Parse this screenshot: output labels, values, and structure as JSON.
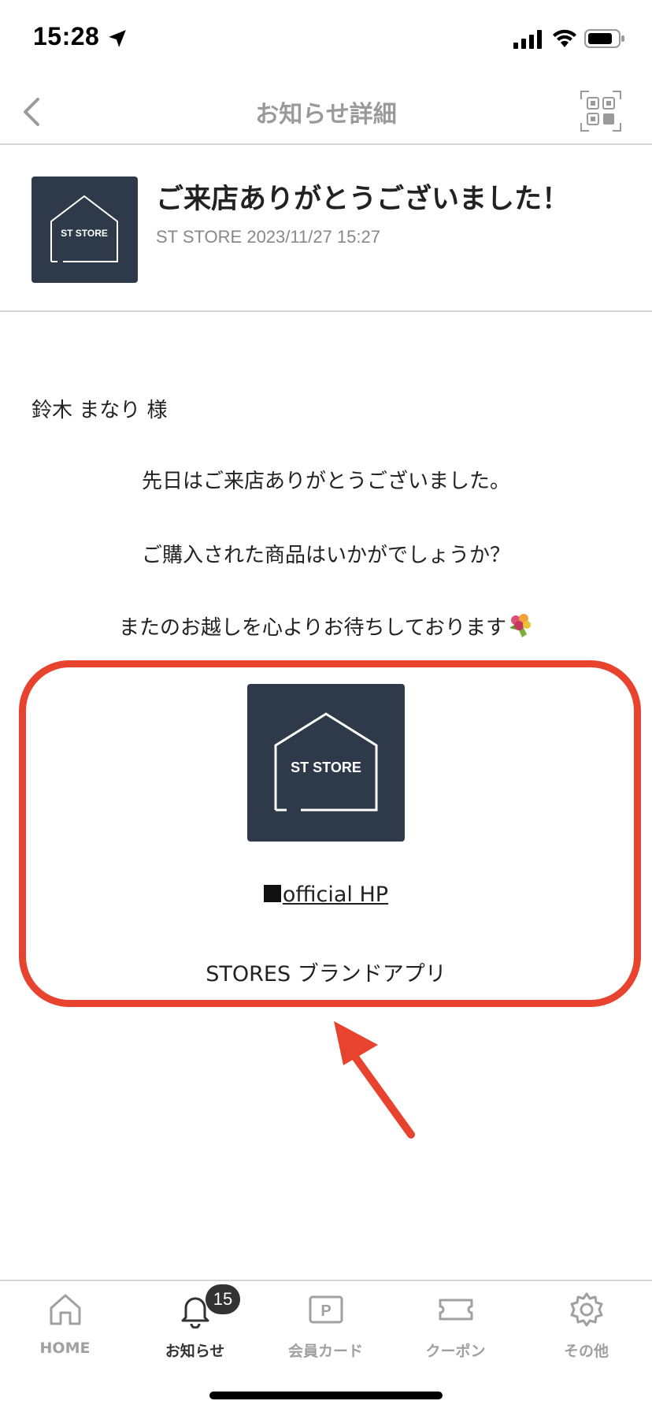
{
  "status_bar": {
    "time": "15:28"
  },
  "nav": {
    "title": "お知らせ詳細"
  },
  "message": {
    "title": "ご来店ありがとうございました！",
    "meta": "ST STORE 2023/11/27 15:27",
    "logo_text": "ST STORE",
    "recipient": "鈴木 まなり 様",
    "lines": [
      "先日はご来店ありがとうございました。",
      "ご購入された商品はいかがでしょうか？",
      "またのお越しを心よりお待ちしております"
    ]
  },
  "highlight": {
    "logo_text": "ST STORE",
    "official_prefix": "■",
    "official_link": "official HP",
    "brand_app": "STORES ブランドアプリ",
    "box_color": "#e8432e"
  },
  "tabs": [
    {
      "label": "HOME",
      "icon": "home-icon"
    },
    {
      "label": "お知らせ",
      "icon": "bell-icon",
      "badge": "15",
      "active": true
    },
    {
      "label": "会員カード",
      "icon": "member-card-icon"
    },
    {
      "label": "クーポン",
      "icon": "coupon-icon"
    },
    {
      "label": "その他",
      "icon": "gear-icon"
    }
  ],
  "colors": {
    "store_dark": "#2e3a4a",
    "accent_red": "#e8432e"
  }
}
